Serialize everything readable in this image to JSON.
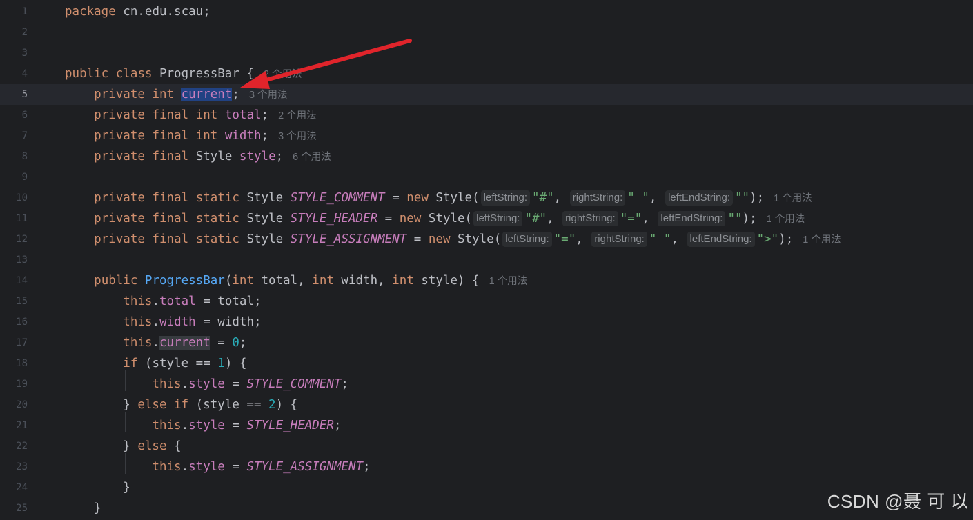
{
  "editor": {
    "line_numbers": [
      "1",
      "2",
      "3",
      "4",
      "5",
      "6",
      "7",
      "8",
      "9",
      "10",
      "11",
      "12",
      "13",
      "14",
      "15",
      "16",
      "17",
      "18",
      "19",
      "20",
      "21",
      "22",
      "23",
      "24",
      "25"
    ],
    "lines": [
      [
        {
          "t": "package",
          "c": "kw"
        },
        {
          "t": " cn.edu.scau;",
          "c": "plain"
        }
      ],
      [],
      [],
      [
        {
          "t": "public",
          "c": "kw"
        },
        {
          "t": " ",
          "c": "plain"
        },
        {
          "t": "class",
          "c": "kw"
        },
        {
          "t": " ProgressBar {",
          "c": "plain"
        },
        {
          "t": "2 个用法",
          "c": "usages"
        }
      ],
      [
        {
          "t": "    ",
          "c": "plain"
        },
        {
          "t": "private",
          "c": "kw"
        },
        {
          "t": " ",
          "c": "plain"
        },
        {
          "t": "int",
          "c": "kw"
        },
        {
          "t": " ",
          "c": "plain"
        },
        {
          "t": "current",
          "c": "sel"
        },
        {
          "t": ";",
          "c": "plain"
        },
        {
          "t": "3 个用法",
          "c": "usages"
        }
      ],
      [
        {
          "t": "    ",
          "c": "plain"
        },
        {
          "t": "private",
          "c": "kw"
        },
        {
          "t": " ",
          "c": "plain"
        },
        {
          "t": "final",
          "c": "kw"
        },
        {
          "t": " ",
          "c": "plain"
        },
        {
          "t": "int",
          "c": "kw"
        },
        {
          "t": " ",
          "c": "plain"
        },
        {
          "t": "total",
          "c": "fld"
        },
        {
          "t": ";",
          "c": "plain"
        },
        {
          "t": "2 个用法",
          "c": "usages"
        }
      ],
      [
        {
          "t": "    ",
          "c": "plain"
        },
        {
          "t": "private",
          "c": "kw"
        },
        {
          "t": " ",
          "c": "plain"
        },
        {
          "t": "final",
          "c": "kw"
        },
        {
          "t": " ",
          "c": "plain"
        },
        {
          "t": "int",
          "c": "kw"
        },
        {
          "t": " ",
          "c": "plain"
        },
        {
          "t": "width",
          "c": "fld"
        },
        {
          "t": ";",
          "c": "plain"
        },
        {
          "t": "3 个用法",
          "c": "usages"
        }
      ],
      [
        {
          "t": "    ",
          "c": "plain"
        },
        {
          "t": "private",
          "c": "kw"
        },
        {
          "t": " ",
          "c": "plain"
        },
        {
          "t": "final",
          "c": "kw"
        },
        {
          "t": " Style ",
          "c": "plain"
        },
        {
          "t": "style",
          "c": "fld"
        },
        {
          "t": ";",
          "c": "plain"
        },
        {
          "t": "6 个用法",
          "c": "usages"
        }
      ],
      [],
      [
        {
          "t": "    ",
          "c": "plain"
        },
        {
          "t": "private",
          "c": "kw"
        },
        {
          "t": " ",
          "c": "plain"
        },
        {
          "t": "final",
          "c": "kw"
        },
        {
          "t": " ",
          "c": "plain"
        },
        {
          "t": "static",
          "c": "kw"
        },
        {
          "t": " Style ",
          "c": "plain"
        },
        {
          "t": "STYLE_COMMENT",
          "c": "cst"
        },
        {
          "t": " = ",
          "c": "plain"
        },
        {
          "t": "new",
          "c": "kw"
        },
        {
          "t": " Style(",
          "c": "plain"
        },
        {
          "t": "leftString:",
          "c": "hint"
        },
        {
          "t": "\"#\"",
          "c": "str"
        },
        {
          "t": ", ",
          "c": "plain"
        },
        {
          "t": "rightString:",
          "c": "hint"
        },
        {
          "t": "\" \"",
          "c": "str"
        },
        {
          "t": ", ",
          "c": "plain"
        },
        {
          "t": "leftEndString:",
          "c": "hint"
        },
        {
          "t": "\"\"",
          "c": "str"
        },
        {
          "t": ");",
          "c": "plain"
        },
        {
          "t": "1 个用法",
          "c": "usages"
        }
      ],
      [
        {
          "t": "    ",
          "c": "plain"
        },
        {
          "t": "private",
          "c": "kw"
        },
        {
          "t": " ",
          "c": "plain"
        },
        {
          "t": "final",
          "c": "kw"
        },
        {
          "t": " ",
          "c": "plain"
        },
        {
          "t": "static",
          "c": "kw"
        },
        {
          "t": " Style ",
          "c": "plain"
        },
        {
          "t": "STYLE_HEADER",
          "c": "cst"
        },
        {
          "t": " = ",
          "c": "plain"
        },
        {
          "t": "new",
          "c": "kw"
        },
        {
          "t": " Style(",
          "c": "plain"
        },
        {
          "t": "leftString:",
          "c": "hint"
        },
        {
          "t": "\"#\"",
          "c": "str"
        },
        {
          "t": ", ",
          "c": "plain"
        },
        {
          "t": "rightString:",
          "c": "hint"
        },
        {
          "t": "\"=\"",
          "c": "str"
        },
        {
          "t": ", ",
          "c": "plain"
        },
        {
          "t": "leftEndString:",
          "c": "hint"
        },
        {
          "t": "\"\"",
          "c": "str"
        },
        {
          "t": ");",
          "c": "plain"
        },
        {
          "t": "1 个用法",
          "c": "usages"
        }
      ],
      [
        {
          "t": "    ",
          "c": "plain"
        },
        {
          "t": "private",
          "c": "kw"
        },
        {
          "t": " ",
          "c": "plain"
        },
        {
          "t": "final",
          "c": "kw"
        },
        {
          "t": " ",
          "c": "plain"
        },
        {
          "t": "static",
          "c": "kw"
        },
        {
          "t": " Style ",
          "c": "plain"
        },
        {
          "t": "STYLE_ASSIGNMENT",
          "c": "cst"
        },
        {
          "t": " = ",
          "c": "plain"
        },
        {
          "t": "new",
          "c": "kw"
        },
        {
          "t": " Style(",
          "c": "plain"
        },
        {
          "t": "leftString:",
          "c": "hint"
        },
        {
          "t": "\"=\"",
          "c": "str"
        },
        {
          "t": ", ",
          "c": "plain"
        },
        {
          "t": "rightString:",
          "c": "hint"
        },
        {
          "t": "\" \"",
          "c": "str"
        },
        {
          "t": ", ",
          "c": "plain"
        },
        {
          "t": "leftEndString:",
          "c": "hint"
        },
        {
          "t": "\">\"",
          "c": "str"
        },
        {
          "t": ");",
          "c": "plain"
        },
        {
          "t": "1 个用法",
          "c": "usages"
        }
      ],
      [],
      [
        {
          "t": "    ",
          "c": "plain"
        },
        {
          "t": "public",
          "c": "kw"
        },
        {
          "t": " ",
          "c": "plain"
        },
        {
          "t": "ProgressBar",
          "c": "fn"
        },
        {
          "t": "(",
          "c": "plain"
        },
        {
          "t": "int",
          "c": "kw"
        },
        {
          "t": " total, ",
          "c": "plain"
        },
        {
          "t": "int",
          "c": "kw"
        },
        {
          "t": " width, ",
          "c": "plain"
        },
        {
          "t": "int",
          "c": "kw"
        },
        {
          "t": " style) {",
          "c": "plain"
        },
        {
          "t": "1 个用法",
          "c": "usages"
        }
      ],
      [
        {
          "t": "        ",
          "c": "plain"
        },
        {
          "t": "this",
          "c": "kw"
        },
        {
          "t": ".",
          "c": "plain"
        },
        {
          "t": "total",
          "c": "fld"
        },
        {
          "t": " = total;",
          "c": "plain"
        }
      ],
      [
        {
          "t": "        ",
          "c": "plain"
        },
        {
          "t": "this",
          "c": "kw"
        },
        {
          "t": ".",
          "c": "plain"
        },
        {
          "t": "width",
          "c": "fld"
        },
        {
          "t": " = width;",
          "c": "plain"
        }
      ],
      [
        {
          "t": "        ",
          "c": "plain"
        },
        {
          "t": "this",
          "c": "kw"
        },
        {
          "t": ".",
          "c": "plain"
        },
        {
          "t": "current",
          "c": "fld readref"
        },
        {
          "t": " = ",
          "c": "plain"
        },
        {
          "t": "0",
          "c": "num"
        },
        {
          "t": ";",
          "c": "plain"
        }
      ],
      [
        {
          "t": "        ",
          "c": "plain"
        },
        {
          "t": "if",
          "c": "kw"
        },
        {
          "t": " (style == ",
          "c": "plain"
        },
        {
          "t": "1",
          "c": "num"
        },
        {
          "t": ") {",
          "c": "plain"
        }
      ],
      [
        {
          "t": "            ",
          "c": "plain"
        },
        {
          "t": "this",
          "c": "kw"
        },
        {
          "t": ".",
          "c": "plain"
        },
        {
          "t": "style",
          "c": "fld"
        },
        {
          "t": " = ",
          "c": "plain"
        },
        {
          "t": "STYLE_COMMENT",
          "c": "cst"
        },
        {
          "t": ";",
          "c": "plain"
        }
      ],
      [
        {
          "t": "        } ",
          "c": "plain"
        },
        {
          "t": "else",
          "c": "kw"
        },
        {
          "t": " ",
          "c": "plain"
        },
        {
          "t": "if",
          "c": "kw"
        },
        {
          "t": " (style == ",
          "c": "plain"
        },
        {
          "t": "2",
          "c": "num"
        },
        {
          "t": ") {",
          "c": "plain"
        }
      ],
      [
        {
          "t": "            ",
          "c": "plain"
        },
        {
          "t": "this",
          "c": "kw"
        },
        {
          "t": ".",
          "c": "plain"
        },
        {
          "t": "style",
          "c": "fld"
        },
        {
          "t": " = ",
          "c": "plain"
        },
        {
          "t": "STYLE_HEADER",
          "c": "cst"
        },
        {
          "t": ";",
          "c": "plain"
        }
      ],
      [
        {
          "t": "        } ",
          "c": "plain"
        },
        {
          "t": "else",
          "c": "kw"
        },
        {
          "t": " {",
          "c": "plain"
        }
      ],
      [
        {
          "t": "            ",
          "c": "plain"
        },
        {
          "t": "this",
          "c": "kw"
        },
        {
          "t": ".",
          "c": "plain"
        },
        {
          "t": "style",
          "c": "fld"
        },
        {
          "t": " = ",
          "c": "plain"
        },
        {
          "t": "STYLE_ASSIGNMENT",
          "c": "cst"
        },
        {
          "t": ";",
          "c": "plain"
        }
      ],
      [
        {
          "t": "        }",
          "c": "plain"
        }
      ],
      [
        {
          "t": "    }",
          "c": "plain"
        }
      ]
    ],
    "current_line": 5
  },
  "watermark": "CSDN @聂 可 以",
  "colors": {
    "background": "#1e1f22",
    "keyword": "#cf8e6d",
    "field": "#c77dbb",
    "method": "#56a8f5",
    "number": "#2aacb8",
    "string": "#6aab73",
    "selection": "#214283",
    "arrow": "#e0242b"
  }
}
